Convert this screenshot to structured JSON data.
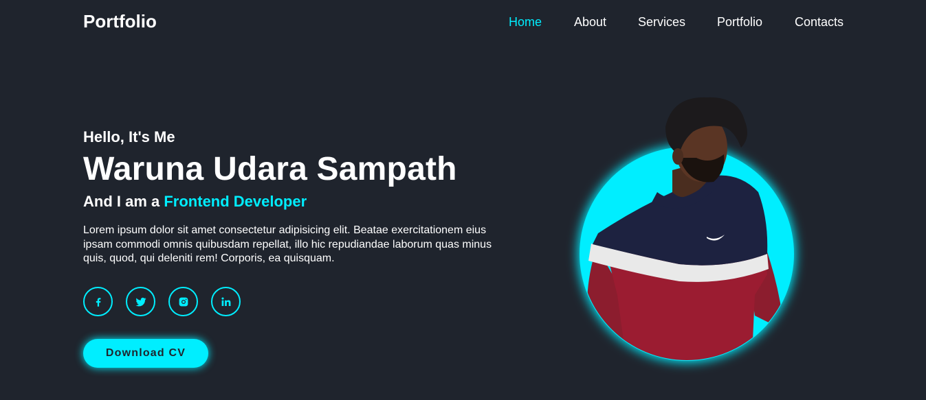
{
  "header": {
    "logo": "Portfolio",
    "nav": [
      {
        "label": "Home",
        "active": true
      },
      {
        "label": "About",
        "active": false
      },
      {
        "label": "Services",
        "active": false
      },
      {
        "label": "Portfolio",
        "active": false
      },
      {
        "label": "Contacts",
        "active": false
      }
    ]
  },
  "hero": {
    "greeting": "Hello, It's Me",
    "name": "Waruna Udara Sampath",
    "role_prefix": "And I am a ",
    "role_highlight": "Frontend Developer",
    "description": "Lorem ipsum dolor sit amet consectetur adipisicing elit. Beatae exercitationem eius ipsam commodi omnis quibusdam repellat, illo hic repudiandae laborum quas minus quis, quod, qui deleniti rem! Corporis, ea quisquam.",
    "download_button": "Download CV"
  },
  "socials": [
    {
      "icon": "facebook-icon"
    },
    {
      "icon": "twitter-icon"
    },
    {
      "icon": "instagram-icon"
    },
    {
      "icon": "linkedin-icon"
    }
  ],
  "colors": {
    "background": "#1f242d",
    "accent": "#00eeff",
    "text": "#ffffff"
  }
}
